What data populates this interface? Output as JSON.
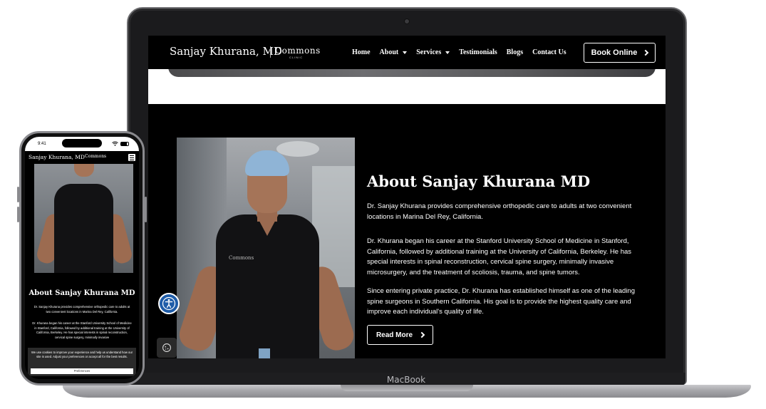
{
  "device": {
    "laptop_label": "MacBook"
  },
  "site": {
    "brand_name": "Sanjay Khurana, MD",
    "brand_logo": "Commons",
    "brand_logo_sub": "CLINIC",
    "nav": [
      "Home",
      "About",
      "Services",
      "Testimonials",
      "Blogs",
      "Contact Us"
    ],
    "nav_dropdowns": [
      "About",
      "Services"
    ],
    "book_online": "Book Online"
  },
  "about": {
    "title": "About Sanjay Khurana MD",
    "p1": "Dr. Sanjay Khurana provides comprehensive orthopedic care to adults at two convenient locations in Marina Del Rey, California.",
    "p2": "Dr. Khurana began his career at the Stanford University School of Medicine in Stanford, California, followed by additional training at the University of California, Berkeley. He has special interests in spinal reconstruction, cervical spine surgery, minimally invasive microsurgery, and the treatment of scoliosis, trauma, and spine tumors.",
    "p3": "Since entering private practice, Dr. Khurana has established himself as one of the leading spine surgeons in Southern California. His goal is to provide the highest quality care and improve each individual's quality of life.",
    "read_more": "Read More",
    "photo_logo": "Commons"
  },
  "phone": {
    "time": "9:41",
    "brand_name": "Sanjay Khurana, MD",
    "brand_logo": "Commons",
    "about_title": "About Sanjay Khurana MD",
    "p1": "Dr. Sanjay Khurana provides comprehensive orthopedic care to adults at two convenient locations in Marina Del Rey, California.",
    "p2": "Dr. Khurana began his career at the Stanford University School of Medicine in Stanford, California, followed by additional training at the University of California, Berkeley. He has special interests in spinal reconstruction, cervical spine surgery, minimally invasive",
    "cookie_text": "We use cookies to improve your experience and help us understand how our site is used. Adjust your preferences or accept all for the best results.",
    "preferences": "Preferences"
  },
  "icons": {
    "accessibility": "accessibility-icon",
    "cookie": "cookie-icon",
    "chevron": "chevron-right-icon",
    "caret": "caret-down-icon",
    "menu": "hamburger-menu-icon",
    "wifi": "wifi-icon",
    "battery": "battery-icon"
  },
  "colors": {
    "accessibility_blue": "#1e5ca8",
    "page_background": "#000000",
    "text": "#ffffff"
  }
}
